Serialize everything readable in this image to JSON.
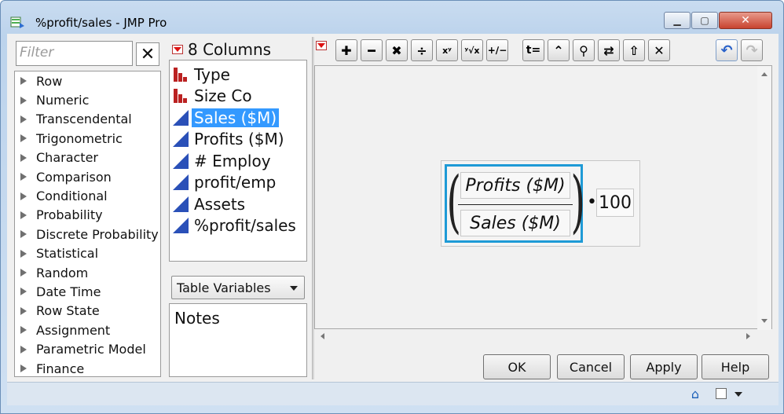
{
  "window": {
    "title": "%profit/sales - JMP Pro",
    "min_glyph": "▁",
    "max_glyph": "▢",
    "close_glyph": "✕"
  },
  "functions": {
    "filter_placeholder": "Filter",
    "clear_glyph": "✕",
    "items": [
      "Row",
      "Numeric",
      "Transcendental",
      "Trigonometric",
      "Character",
      "Comparison",
      "Conditional",
      "Probability",
      "Discrete Probability",
      "Statistical",
      "Random",
      "Date Time",
      "Row State",
      "Assignment",
      "Parametric Model",
      "Finance"
    ]
  },
  "columns": {
    "count_label": "8 Columns",
    "items": [
      {
        "label": "Type",
        "icon": "nominal-bars-icon",
        "selected": false
      },
      {
        "label": "Size Co",
        "icon": "nominal-bars-icon",
        "selected": false
      },
      {
        "label": "Sales ($M)",
        "icon": "continuous-triangle-icon",
        "selected": true
      },
      {
        "label": "Profits ($M)",
        "icon": "continuous-triangle-icon",
        "selected": false
      },
      {
        "label": "# Employ",
        "icon": "continuous-triangle-icon",
        "selected": false
      },
      {
        "label": "profit/emp",
        "icon": "continuous-triangle-icon",
        "selected": false
      },
      {
        "label": "Assets",
        "icon": "continuous-triangle-icon",
        "selected": false
      },
      {
        "label": "%profit/sales",
        "icon": "continuous-triangle-icon",
        "selected": false
      }
    ],
    "table_variables_label": "Table Variables",
    "notes_label": "Notes"
  },
  "toolbar": {
    "buttons": [
      {
        "name": "add-button",
        "glyph": "✚"
      },
      {
        "name": "subtract-button",
        "glyph": "━"
      },
      {
        "name": "multiply-button",
        "glyph": "✖"
      },
      {
        "name": "divide-button",
        "glyph": "÷"
      },
      {
        "name": "power-button",
        "glyph": "xʸ"
      },
      {
        "name": "root-button",
        "glyph": "ʸ√x"
      },
      {
        "name": "negate-button",
        "glyph": "+∕−"
      },
      {
        "name": "assign-button",
        "glyph": "t="
      },
      {
        "name": "peel-up-button",
        "glyph": "⌃"
      },
      {
        "name": "search-button",
        "glyph": "⚲"
      },
      {
        "name": "swap-button",
        "glyph": "⇄"
      },
      {
        "name": "move-up-button",
        "glyph": "⇧"
      },
      {
        "name": "delete-button",
        "glyph": "✕"
      }
    ],
    "undo_glyph": "↶",
    "redo_glyph": "↷"
  },
  "formula": {
    "numerator": "Profits ($M)",
    "denominator": "Sales ($M)",
    "operator": "•",
    "constant": "100"
  },
  "dialog_buttons": {
    "ok": "OK",
    "cancel": "Cancel",
    "apply": "Apply",
    "help": "Help"
  },
  "status": {
    "home_glyph": "⌂"
  }
}
